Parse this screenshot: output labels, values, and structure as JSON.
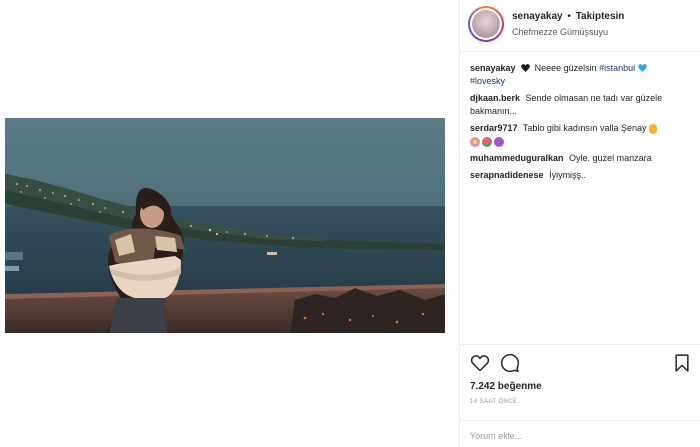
{
  "header": {
    "username": "senayakay",
    "separator": "•",
    "follow_status": "Takiptesin",
    "location": "Chefmezze Gümüşsuyu"
  },
  "caption": {
    "username": "senayakay",
    "text": "Neeee güzelsin",
    "tags": [
      "#istanbul",
      "#lovesky"
    ]
  },
  "comments": [
    {
      "username": "djkaan.berk",
      "text": "Sende olmasan ne tadı var güzele bakmanın..."
    },
    {
      "username": "serdar9717",
      "text": "Tablo gibi kadınsın valla Şenay"
    },
    {
      "username": "muhammeduguralkan",
      "text": "Oyle. guzel manzara"
    },
    {
      "username": "serapnadidenese",
      "text": "İyiymişş.."
    }
  ],
  "icons": {
    "caption_heart": "black-heart-icon",
    "caption_blue_heart": "blue-heart-icon",
    "like": "heart-outline-icon",
    "comment": "comment-bubble-icon",
    "save": "bookmark-icon"
  },
  "stats": {
    "likes": "7.242 beğenme",
    "time": "14 SAAT ÖNCE"
  },
  "add_comment": {
    "placeholder": "Yorum ekle..."
  },
  "colors": {
    "tag": "#1a3a6e",
    "text": "#262626",
    "muted": "#999999",
    "blue_heart": "#2aa6d8"
  }
}
